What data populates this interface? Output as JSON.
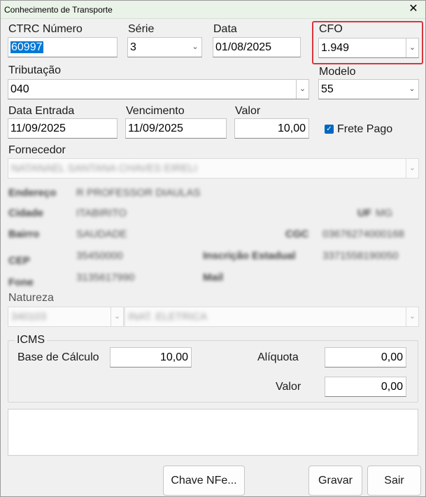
{
  "window": {
    "title": "Conhecimento de Transporte",
    "close_glyph": "✕"
  },
  "fields": {
    "ctrc_numero": {
      "label": "CTRC Número",
      "value": "60997"
    },
    "serie": {
      "label": "Série",
      "value": "3"
    },
    "data": {
      "label": "Data",
      "value": "01/08/2025"
    },
    "cfo": {
      "label": "CFO",
      "value": "1.949"
    },
    "tributacao": {
      "label": "Tributação",
      "value": "040"
    },
    "modelo": {
      "label": "Modelo",
      "value": "55"
    },
    "data_entrada": {
      "label": "Data Entrada",
      "value": "11/09/2025"
    },
    "vencimento": {
      "label": "Vencimento",
      "value": "11/09/2025"
    },
    "valor": {
      "label": "Valor",
      "value": "10,00"
    },
    "frete_pago": {
      "label": "Frete Pago",
      "checked": true
    },
    "fornecedor": {
      "label": "Fornecedor",
      "value": "NATANAEL SANTANA CHAVES EIRELI"
    },
    "natureza": {
      "label": "Natureza",
      "code": "340103",
      "description": "INAT. ELETRICA"
    }
  },
  "fornecedor_info": {
    "endereco_label": "Endereço",
    "endereco_value": "R PROFESSOR DIAULAS",
    "cidade_label": "Cidade",
    "cidade_value": "ITABIRITO",
    "uf_label": "UF",
    "uf_value": "MG",
    "bairro_label": "Bairro",
    "bairro_value": "SAUDADE",
    "cgc_label": "CGC",
    "cgc_value": "03676274000168",
    "cep_label": "CEP",
    "cep_value": "35450000",
    "inscricao_label": "Inscrição Estadual",
    "inscricao_value": "3371558190050",
    "fone_label": "Fone",
    "fone_value": "3135617990",
    "mail_label": "Mail"
  },
  "icms": {
    "title": "ICMS",
    "base_label": "Base de Cálculo",
    "base_value": "10,00",
    "aliquota_label": "Alíquota",
    "aliquota_value": "0,00",
    "valor_label": "Valor",
    "valor_value": "0,00"
  },
  "buttons": {
    "chave_nfe": "Chave NFe...",
    "gravar": "Gravar",
    "sair": "Sair"
  },
  "icons": {
    "chevron": "chevron-down-icon",
    "check": "checkbox-checked-icon"
  },
  "colors": {
    "accent": "#0078d7",
    "highlight": "#d9363e",
    "titlebar": "#eaf3e7"
  }
}
